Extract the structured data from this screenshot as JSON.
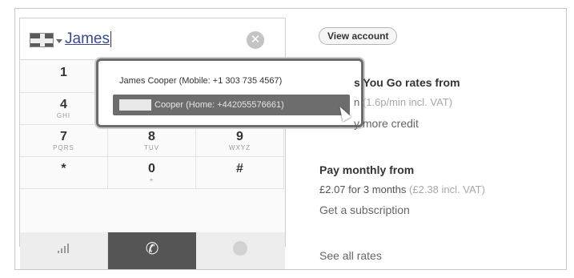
{
  "dialer": {
    "number_value": "James",
    "clear_symbol": "✕",
    "keys": [
      {
        "digit": "1",
        "letters": ""
      },
      {
        "digit": "4",
        "letters": "GHI"
      },
      {
        "digit": "7",
        "letters": "PQRS"
      },
      {
        "digit": "8",
        "letters": "TUV"
      },
      {
        "digit": "9",
        "letters": "WXYZ"
      },
      {
        "digit": "*",
        "letters": ""
      },
      {
        "digit": "0",
        "letters": "+"
      },
      {
        "digit": "#",
        "letters": ""
      }
    ],
    "call_symbol": "✆"
  },
  "suggestions": {
    "items": [
      {
        "label": "James Cooper (Mobile: +1 303 735 4567)"
      },
      {
        "label": "Cooper (Home: +442055576661)"
      }
    ]
  },
  "panel": {
    "view_account_label": "View account",
    "payg_title": "s You Go rates from",
    "payg_price": "n",
    "payg_price_note": "(1.6p/min incl. VAT)",
    "payg_link": "y more credit",
    "monthly_title": "Pay monthly from",
    "monthly_price": "£2.07 for 3 months",
    "monthly_price_note": "(£2.38 incl. VAT)",
    "monthly_link": "Get a subscription",
    "all_rates_link": "See all rates"
  },
  "icons": {
    "flag": "uk-flag-icon",
    "clear": "clear-icon",
    "signal": "signal-icon",
    "call": "phone-icon",
    "chat": "chat-icon"
  }
}
